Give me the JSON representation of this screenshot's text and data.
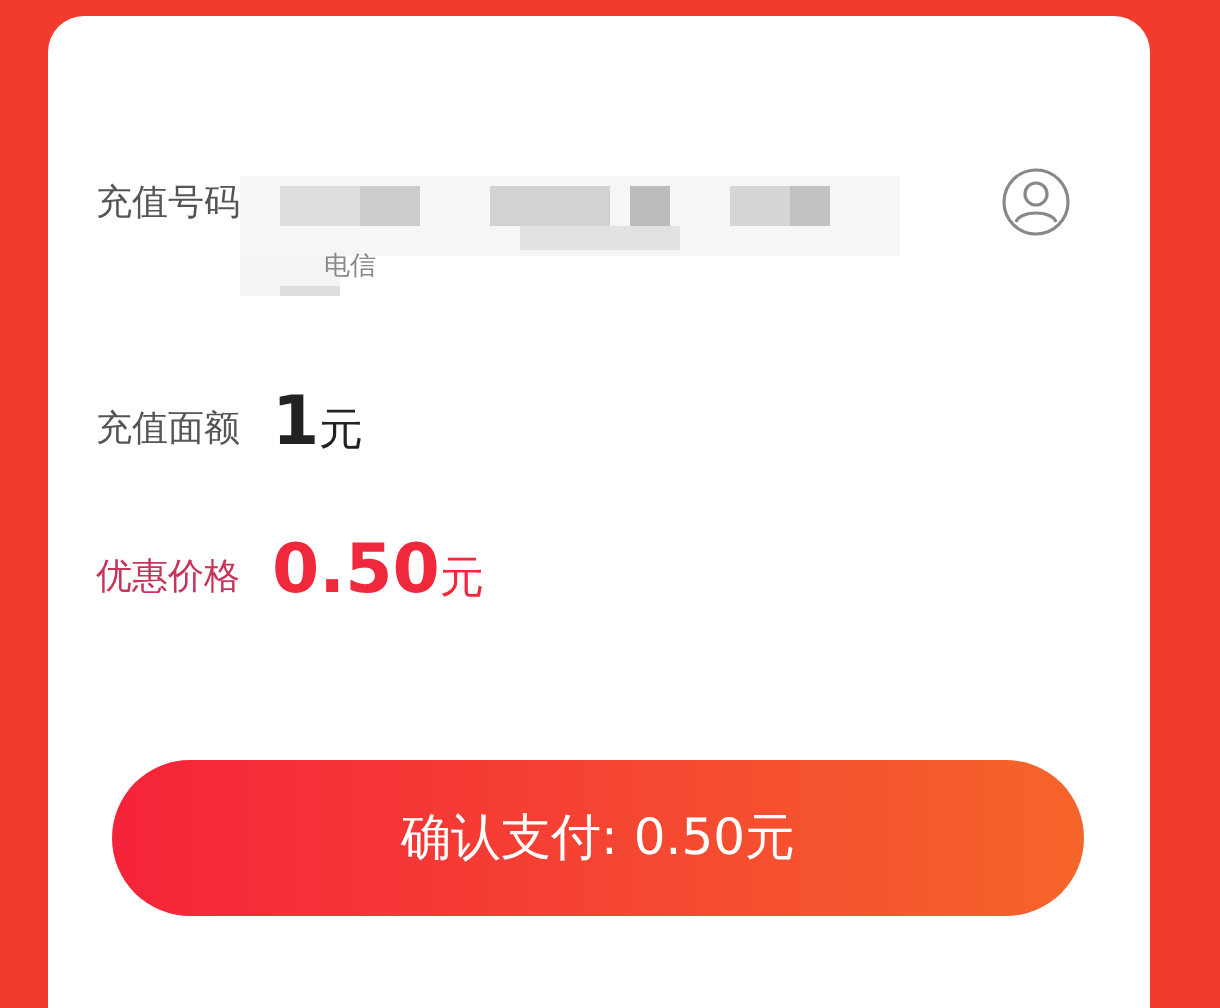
{
  "recharge_number": {
    "label": "充值号码",
    "carrier": "电信"
  },
  "face_value": {
    "label": "充值面额",
    "amount": "1",
    "unit": "元"
  },
  "discount_price": {
    "label": "优惠价格",
    "amount": "0.50",
    "unit": "元"
  },
  "pay_button": {
    "label": "确认支付: 0.50元"
  }
}
